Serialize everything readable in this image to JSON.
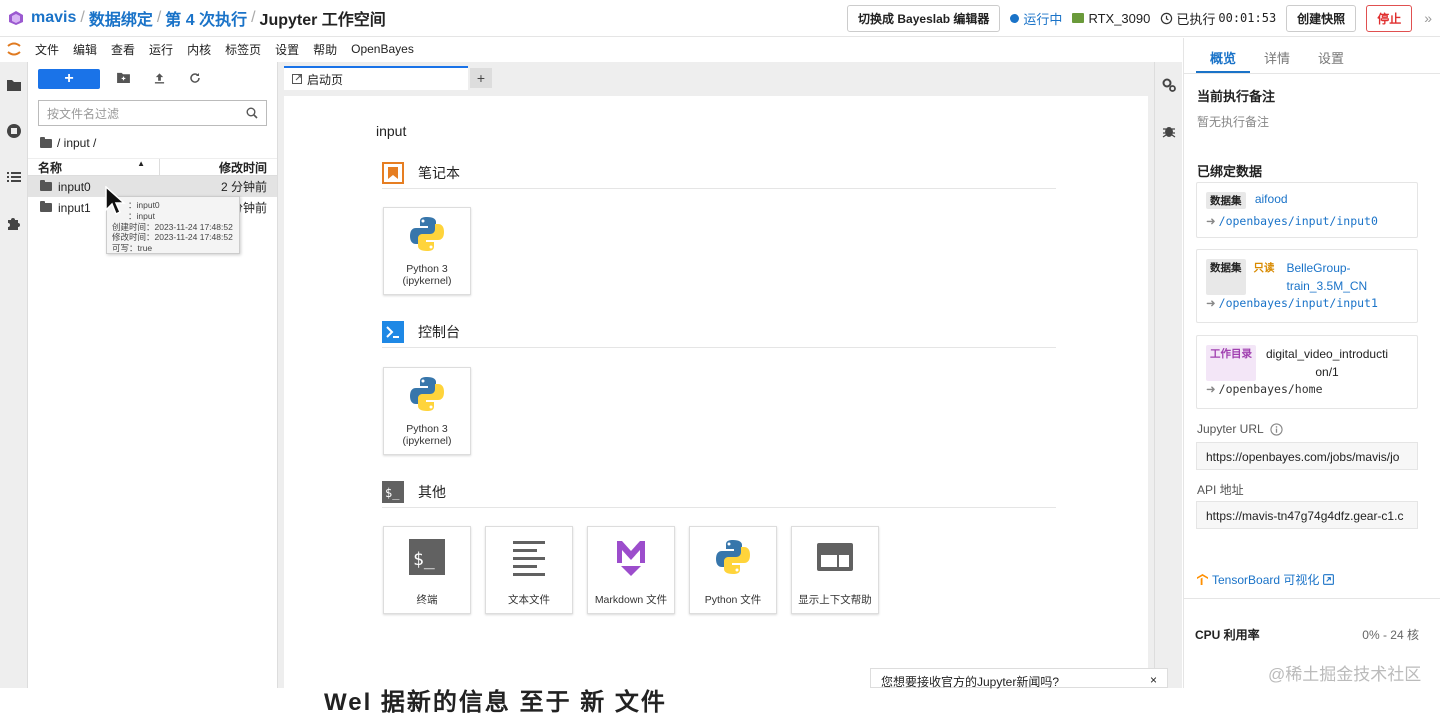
{
  "header": {
    "breadcrumbs": [
      "mavis",
      "数据绑定",
      "第 4 次执行",
      "Jupyter 工作空间"
    ],
    "separator": "/",
    "switch_editor_label": "切换成 Bayeslab 编辑器",
    "status_label": "运行中",
    "gpu_label": "RTX_3090",
    "elapsed_label": "已执行",
    "elapsed_time": "00:01:53",
    "snapshot_label": "创建快照",
    "stop_label": "停止",
    "collapse_glyph": "»"
  },
  "menu": {
    "items": [
      "文件",
      "编辑",
      "查看",
      "运行",
      "内核",
      "标签页",
      "设置",
      "帮助",
      "OpenBayes"
    ]
  },
  "filebrowser": {
    "new_label": "+",
    "filter_placeholder": "按文件名过滤",
    "path": "/ input /",
    "col_name": "名称",
    "col_modified": "修改时间",
    "files": [
      {
        "name": "input0",
        "modified": "2 分钟前"
      },
      {
        "name": "input1",
        "modified": "分钟前"
      }
    ],
    "tooltip": {
      "line1": "：input0",
      "line2": "：input",
      "line3": "创建时间：2023-11-24 17:48:52",
      "line4": "修改时间：2023-11-24 17:48:52",
      "line5": "可写：true"
    }
  },
  "tabs": {
    "launcher_tab": "启动页",
    "add_label": "+"
  },
  "launcher": {
    "title": "input",
    "sections": {
      "notebook": "笔记本",
      "console": "控制台",
      "other": "其他"
    },
    "notebook_card": {
      "line1": "Python 3",
      "line2": "(ipykernel)"
    },
    "console_card": {
      "line1": "Python 3",
      "line2": "(ipykernel)"
    },
    "other_cards": [
      "终端",
      "文本文件",
      "Markdown 文件",
      "Python 文件",
      "显示上下文帮助"
    ],
    "bottom_text": "Wel      据新的信息 至于 新 文件"
  },
  "toast": {
    "message": "您想要接收官方的Jupyter新闻吗?",
    "close_glyph": "×"
  },
  "right_panel": {
    "tabs": [
      "概览",
      "详情",
      "设置"
    ],
    "note_title": "当前执行备注",
    "note_empty": "暂无执行备注",
    "bound_title": "已绑定数据",
    "bindings": [
      {
        "badge": "数据集",
        "readonly": "",
        "name": "aifood",
        "mount": "/openbayes/input/input0"
      },
      {
        "badge": "数据集",
        "readonly": "只读",
        "name": "BelleGroup-train_3.5M_CN",
        "name_line1": "BelleGroup-",
        "name_line2": "train_3.5M_CN",
        "mount": "/openbayes/input/input1"
      },
      {
        "badge": "工作目录",
        "readonly": "",
        "name_line1": "digital_video_introducti",
        "name_line2": "on/1",
        "mount": "/openbayes/home"
      }
    ],
    "jupyter_url_label": "Jupyter URL",
    "jupyter_url": "https://openbayes.com/jobs/mavis/jo",
    "api_label": "API 地址",
    "api_url": "https://mavis-tn47g74g4dfz.gear-c1.c",
    "tensorboard_label": "TensorBoard 可视化",
    "cpu_label": "CPU 利用率",
    "cpu_range": "0% - 24 核"
  },
  "watermark": "@稀土掘金技术社区",
  "colors": {
    "accent": "#1a73c8",
    "primary_button": "#1a73e8",
    "stop": "#e03030",
    "readonly": "#d88a00"
  }
}
